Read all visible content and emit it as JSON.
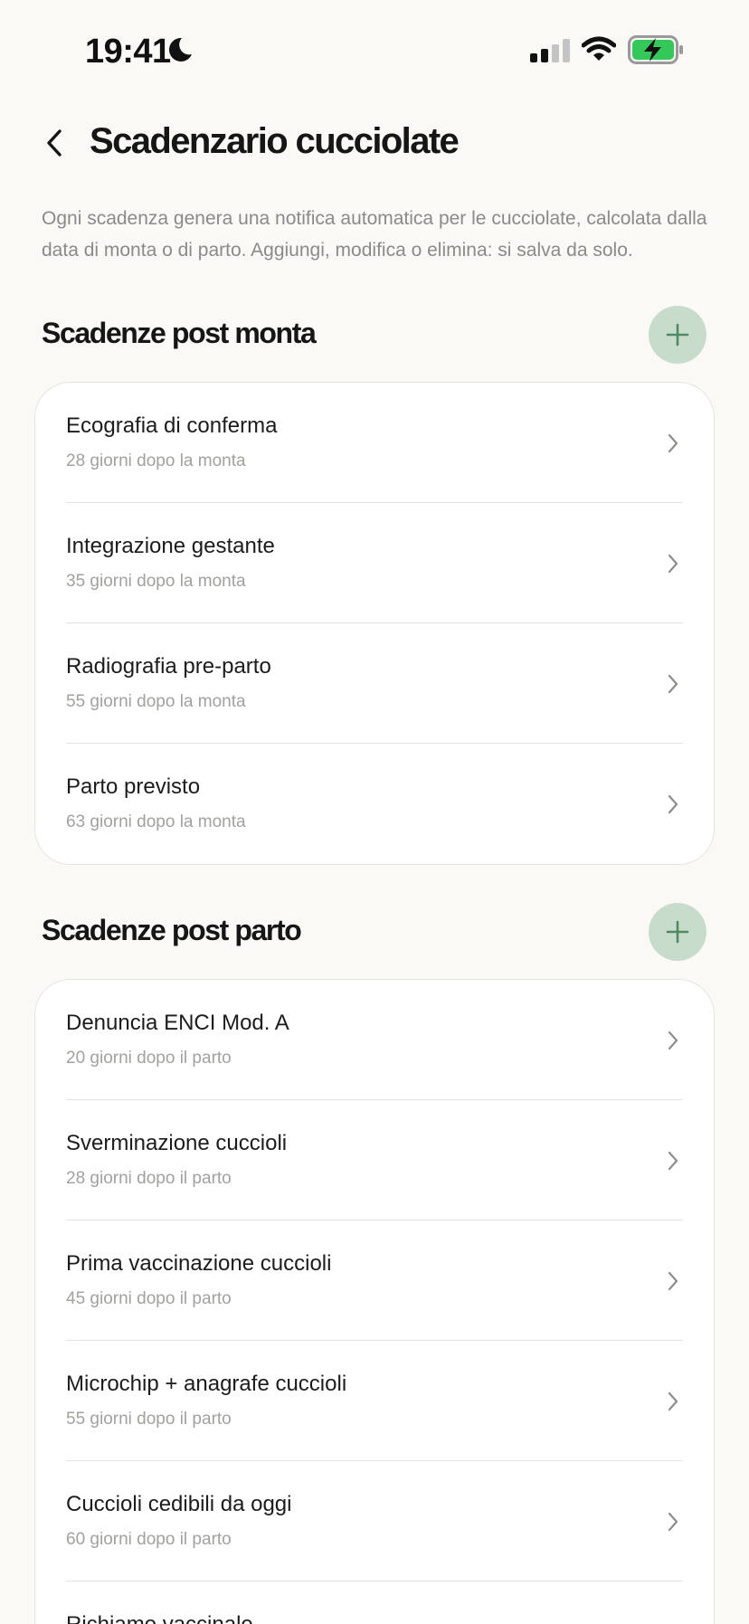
{
  "status_bar": {
    "time": "19:41"
  },
  "header": {
    "title": "Scadenzario cucciolate"
  },
  "description": "Ogni scadenza genera una notifica automatica per le cucciolate, calcolata dalla data di monta o di parto. Aggiungi, modifica o elimina: si salva da solo.",
  "sections": [
    {
      "title": "Scadenze post monta",
      "items": [
        {
          "title": "Ecografia di conferma",
          "subtitle": "28 giorni dopo la monta"
        },
        {
          "title": "Integrazione gestante",
          "subtitle": "35 giorni dopo la monta"
        },
        {
          "title": "Radiografia pre-parto",
          "subtitle": "55 giorni dopo la monta"
        },
        {
          "title": "Parto previsto",
          "subtitle": "63 giorni dopo la monta"
        }
      ]
    },
    {
      "title": "Scadenze post parto",
      "items": [
        {
          "title": "Denuncia ENCI Mod. A",
          "subtitle": "20 giorni dopo il parto"
        },
        {
          "title": "Sverminazione cuccioli",
          "subtitle": "28 giorni dopo il parto"
        },
        {
          "title": "Prima vaccinazione cuccioli",
          "subtitle": "45 giorni dopo il parto"
        },
        {
          "title": "Microchip + anagrafe cuccioli",
          "subtitle": "55 giorni dopo il parto"
        },
        {
          "title": "Cuccioli cedibili da oggi",
          "subtitle": "60 giorni dopo il parto"
        },
        {
          "title": "Richiamo vaccinale",
          "subtitle": ""
        }
      ]
    }
  ],
  "colors": {
    "background": "#fbf9f5",
    "add_button_bg": "#c8dccc",
    "add_button_icon": "#4f8a62",
    "battery_fill": "#34c759"
  }
}
